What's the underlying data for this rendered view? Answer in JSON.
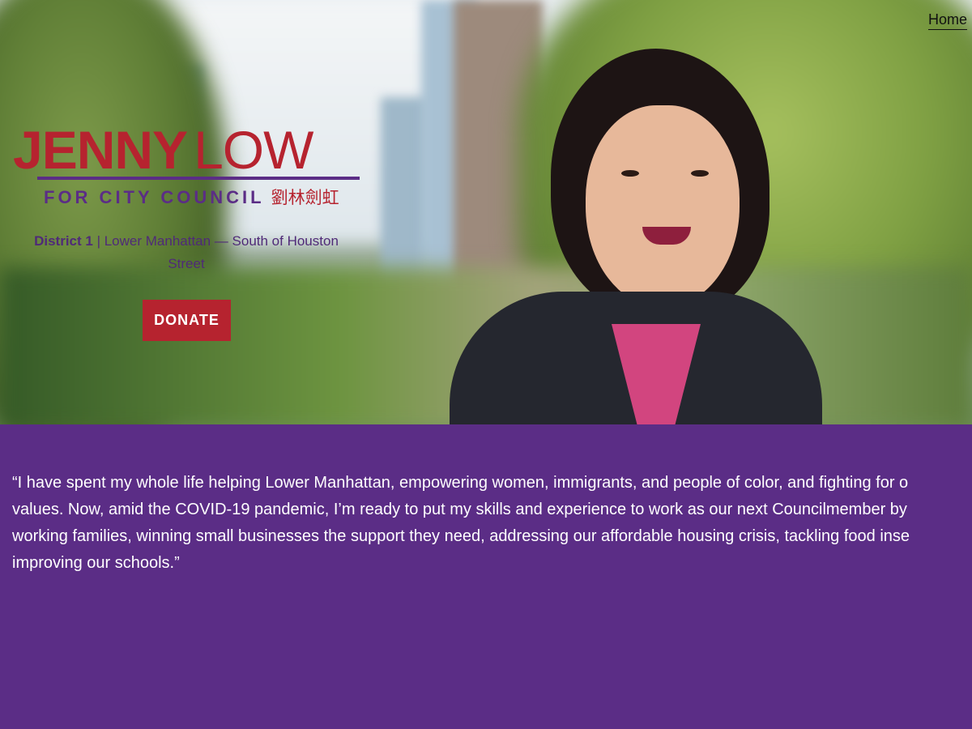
{
  "nav": {
    "home_label": "Home"
  },
  "logo": {
    "first_name": "JENNY",
    "last_name": "LOW",
    "subtitle": "FOR CITY COUNCIL",
    "chinese_name": "劉林劍虹"
  },
  "district": {
    "label": "District 1",
    "separator": " | ",
    "description": "Lower Manhattan — South of Houston Street"
  },
  "donate": {
    "label": "DONATE"
  },
  "quote": {
    "lines": [
      "“I have spent my whole life helping Lower Manhattan, empowering women, immigrants, and people of color, and fighting for o",
      "values. Now, amid the COVID-19 pandemic, I’m ready to put my skills and experience to work as our next Councilmember by",
      "working families, winning small businesses the support they need, addressing our affordable housing crisis, tackling food inse",
      "improving our schools.”"
    ]
  },
  "colors": {
    "brand_red": "#b6232f",
    "brand_purple": "#5b2d86",
    "text_white": "#ffffff"
  }
}
